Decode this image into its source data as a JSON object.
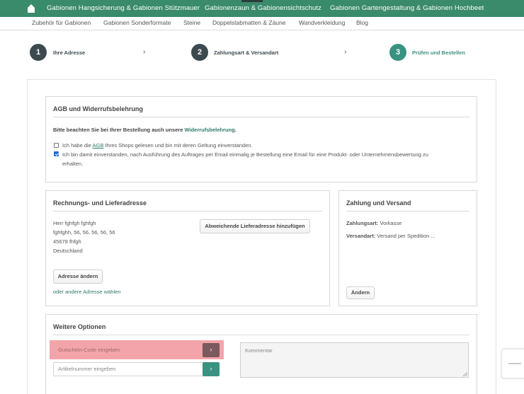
{
  "top_nav": {
    "items": [
      "Gabionen Hangsicherung & Gabionen Stützmauer",
      "Gabionenzaun & Gabionensichtschutz",
      "Gabionen Gartengestaltung & Gabionen Hochbeet"
    ],
    "home_icon": "home-icon",
    "background": "#3a8a6c"
  },
  "sub_nav": {
    "items": [
      "Zubehör für Gabionen",
      "Gabionen Sonderformate",
      "Steine",
      "Doppelstabmatten & Zäune",
      "Wandverkleidung",
      "Blog"
    ]
  },
  "steps": [
    {
      "number": "1",
      "label": "Ihre Adresse"
    },
    {
      "number": "2",
      "label": "Zahlungsart & Versandart"
    },
    {
      "number": "3",
      "label": "Prüfen und Bestellen"
    }
  ],
  "agb": {
    "title": "AGB und Widerrufsbelehrung",
    "notice_prefix": "Bitte beachten Sie bei Ihrer Bestellung auch unsere ",
    "notice_link": "Widerrufsbelehrung",
    "notice_suffix": ".",
    "check1_prefix": "Ich habe die ",
    "check1_link": "AGB",
    "check1_suffix": " Ihres Shops gelesen und bin mit deren Geltung einverstanden.",
    "check1_checked": false,
    "check2_line1": "Ich bin damit einverstanden, nach Ausführung des Auftrages per Email einmalig je Bestellung eine Email für eine Produkt- oder Unternehmensbewertung zu",
    "check2_line2": "erhalten.",
    "check2_checked": true
  },
  "address": {
    "title": "Rechnungs- und Lieferadresse",
    "lines": [
      "Herr fghfgh fghfgh",
      "fghfghh, 56, 56, 56, 56, 56",
      "45678 fhfgh",
      "Deutschland"
    ],
    "alt_delivery_button": "Abweichende Lieferadresse hinzufügen",
    "change_button": "Adresse ändern",
    "other_link": "oder andere Adresse wählen"
  },
  "payment": {
    "title": "Zahlung und Versand",
    "payment_label": "Zahlungsart:",
    "payment_value": " Vorkasse",
    "shipping_label": "Versandart:",
    "shipping_value": " Versand per Spedition ...",
    "change_button": "Ändern"
  },
  "options": {
    "title": "Weitere Optionen",
    "voucher_placeholder": "Gutschein-Code eingeben",
    "article_placeholder": "Artikelnummer eingeben",
    "comment_placeholder": "Kommentar",
    "arrow": "›"
  },
  "colors": {
    "accent": "#3a9280",
    "dark": "#3c4a4f",
    "link": "#2e7b69",
    "highlight": "#f3a4aa"
  }
}
